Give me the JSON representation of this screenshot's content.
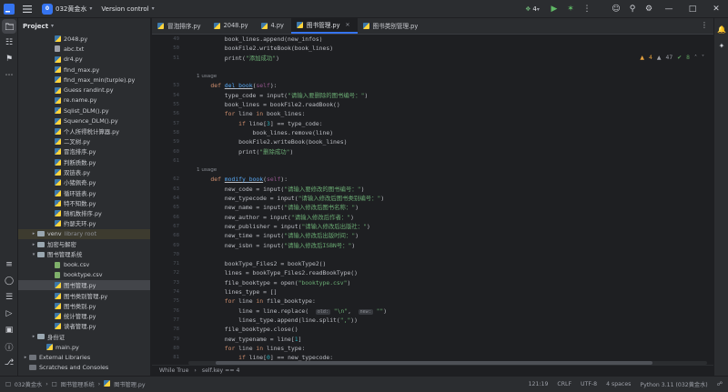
{
  "titlebar": {
    "project_badge": "0",
    "project_name": "032黄金水",
    "vcs": "Version control",
    "run_config_count": "4"
  },
  "project_panel": {
    "title": "Project",
    "items": [
      {
        "name": "2048.py",
        "type": "py",
        "indent": 3
      },
      {
        "name": "abc.txt",
        "type": "txt",
        "indent": 3
      },
      {
        "name": "dr4.py",
        "type": "py",
        "indent": 3
      },
      {
        "name": "find_max.py",
        "type": "py",
        "indent": 3
      },
      {
        "name": "find_max_min(turple).py",
        "type": "py",
        "indent": 3
      },
      {
        "name": "Guess randint.py",
        "type": "py",
        "indent": 3
      },
      {
        "name": "re.name.py",
        "type": "py",
        "indent": 3
      },
      {
        "name": "Sqlist_DLM().py",
        "type": "py",
        "indent": 3
      },
      {
        "name": "Squence_DLM().py",
        "type": "py",
        "indent": 3
      },
      {
        "name": "个人所得税计算器.py",
        "type": "py",
        "indent": 3
      },
      {
        "name": "二叉树.py",
        "type": "py",
        "indent": 3
      },
      {
        "name": "冒泡排序.py",
        "type": "py",
        "indent": 3
      },
      {
        "name": "判断质数.py",
        "type": "py",
        "indent": 3
      },
      {
        "name": "双链表.py",
        "type": "py",
        "indent": 3
      },
      {
        "name": "小猪佩奇.py",
        "type": "py",
        "indent": 3
      },
      {
        "name": "循环链表.py",
        "type": "py",
        "indent": 3
      },
      {
        "name": "特不知数.py",
        "type": "py",
        "indent": 3
      },
      {
        "name": "随机数排序.py",
        "type": "py",
        "indent": 3
      },
      {
        "name": "约瑟夫环.py",
        "type": "py",
        "indent": 3
      },
      {
        "name": "venv",
        "type": "dir",
        "indent": 1,
        "hint": "library root",
        "arrow": "closed",
        "venv": true
      },
      {
        "name": "加密与解密",
        "type": "dir",
        "indent": 1,
        "arrow": "closed"
      },
      {
        "name": "图书管理系统",
        "type": "dir",
        "indent": 1,
        "arrow": "open"
      },
      {
        "name": "book.csv",
        "type": "csv",
        "indent": 3
      },
      {
        "name": "booktype.csv",
        "type": "csv",
        "indent": 3
      },
      {
        "name": "图书管理.py",
        "type": "py",
        "indent": 3,
        "selected": true
      },
      {
        "name": "图书类别管理.py",
        "type": "py",
        "indent": 3
      },
      {
        "name": "图书类别.py",
        "type": "py",
        "indent": 3
      },
      {
        "name": "统计管理.py",
        "type": "py",
        "indent": 3
      },
      {
        "name": "读者管理.py",
        "type": "py",
        "indent": 3
      },
      {
        "name": "身份证",
        "type": "dir",
        "indent": 1,
        "arrow": "closed"
      },
      {
        "name": "main.py",
        "type": "py",
        "indent": 2
      },
      {
        "name": "External Libraries",
        "type": "lib",
        "indent": 0,
        "arrow": "closed"
      },
      {
        "name": "Scratches and Consoles",
        "type": "lib",
        "indent": 0
      }
    ]
  },
  "tabs": [
    {
      "label": "冒泡排序.py",
      "active": false
    },
    {
      "label": "2048.py",
      "active": false
    },
    {
      "label": "4.py",
      "active": false
    },
    {
      "label": "图书管理.py",
      "active": true
    },
    {
      "label": "图书类别管理.py",
      "active": false
    }
  ],
  "inspections": {
    "warnings": "4",
    "weak": "47",
    "ok": "8"
  },
  "code": [
    {
      "n": "49",
      "t": "        book_lines.append(new_infos)"
    },
    {
      "n": "50",
      "t": "        bookFile2.writeBook(book_lines)"
    },
    {
      "n": "51",
      "t": "        print(\"添加成功\")"
    },
    {
      "n": "",
      "t": ""
    },
    {
      "n": "",
      "t": "1 usage",
      "usage": true
    },
    {
      "n": "53",
      "t": "    def del_book(self):"
    },
    {
      "n": "54",
      "t": "        type_code = input(\"请输入要删除的图书编号：\")"
    },
    {
      "n": "55",
      "t": "        book_lines = bookFile2.readBook()"
    },
    {
      "n": "56",
      "t": "        for line in book_lines:"
    },
    {
      "n": "57",
      "t": "            if line[3] == type_code:"
    },
    {
      "n": "58",
      "t": "                book_lines.remove(line)"
    },
    {
      "n": "59",
      "t": "            bookFile2.writeBook(book_lines)"
    },
    {
      "n": "60",
      "t": "            print(\"删除成功\")"
    },
    {
      "n": "61",
      "t": ""
    },
    {
      "n": "",
      "t": "1 usage",
      "usage": true
    },
    {
      "n": "62",
      "t": "    def modify_book(self):"
    },
    {
      "n": "63",
      "t": "        new_code = input(\"请输入要修改的图书编号：\")"
    },
    {
      "n": "64",
      "t": "        new_typecode = input(\"请输入修改后图书类别编号：\")"
    },
    {
      "n": "65",
      "t": "        new_name = input(\"请输入修改后图书名称：\")"
    },
    {
      "n": "66",
      "t": "        new_author = input(\"请输入修改后作者：\")"
    },
    {
      "n": "67",
      "t": "        new_publisher = input(\"请输入修改后出版社：\")"
    },
    {
      "n": "68",
      "t": "        new_time = input(\"请输入修改后出版时间：\")"
    },
    {
      "n": "69",
      "t": "        new_isbn = input(\"请输入修改后ISBN号：\")"
    },
    {
      "n": "70",
      "t": ""
    },
    {
      "n": "71",
      "t": "        bookType_Files2 = bookType2()"
    },
    {
      "n": "72",
      "t": "        lines = bookType_Files2.readBookType()"
    },
    {
      "n": "73",
      "t": "        file_booktype = open(\"booktype.csv\")"
    },
    {
      "n": "74",
      "t": "        lines_type = []"
    },
    {
      "n": "75",
      "t": "        for line in file_booktype:"
    },
    {
      "n": "76",
      "t": "            line = line.replace(  old: \"\\n\",  new: \"\")"
    },
    {
      "n": "77",
      "t": "            lines_type.append(line.split(\",\"))"
    },
    {
      "n": "78",
      "t": "        file_booktype.close()"
    },
    {
      "n": "79",
      "t": "        new_typename = line[1]"
    },
    {
      "n": "80",
      "t": "        for line in lines_type:"
    },
    {
      "n": "81",
      "t": "            if line[0] == new_typecode:"
    }
  ],
  "breadcrumb": [
    "While True",
    "self.key == 4"
  ],
  "status": {
    "path": [
      "032黄金水",
      "图书管理系统",
      "图书管理.py"
    ],
    "position": "121:19",
    "line_sep": "CRLF",
    "encoding": "UTF-8",
    "indent": "4 spaces",
    "interpreter": "Python 3.11 (032黄金水)"
  }
}
